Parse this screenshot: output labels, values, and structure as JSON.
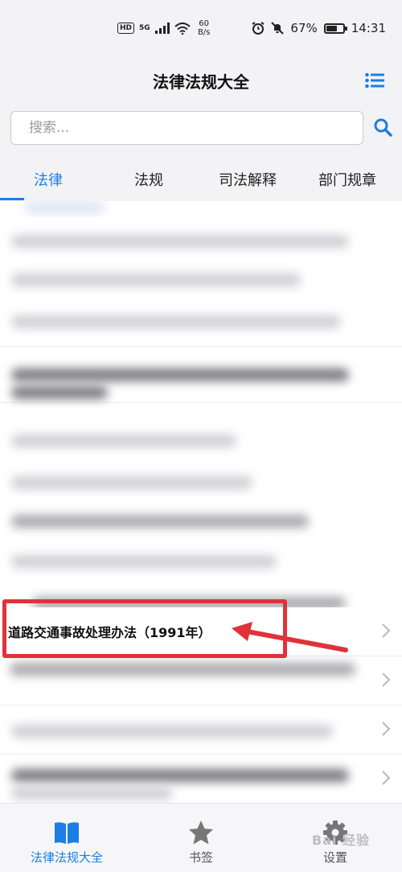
{
  "status_bar": {
    "hd": "HD",
    "signal": "5G",
    "speed_value": "60",
    "speed_unit": "B/s",
    "battery": "67%",
    "battery_level": 0.67,
    "time": "14:31"
  },
  "header": {
    "title": "法律法规大全"
  },
  "search": {
    "placeholder": "搜索..."
  },
  "tabs": [
    {
      "label": "法律"
    },
    {
      "label": "法规"
    },
    {
      "label": "司法解释"
    },
    {
      "label": "部门规章"
    }
  ],
  "list": {
    "highlighted_item": "道路交通事故处理办法（1991年）"
  },
  "bottom_nav": [
    {
      "label": "法律法规大全"
    },
    {
      "label": "书签"
    },
    {
      "label": "设置"
    }
  ],
  "watermark": "Bai 经验",
  "colors": {
    "accent": "#1a7ee5",
    "annotation": "#e0323a"
  }
}
